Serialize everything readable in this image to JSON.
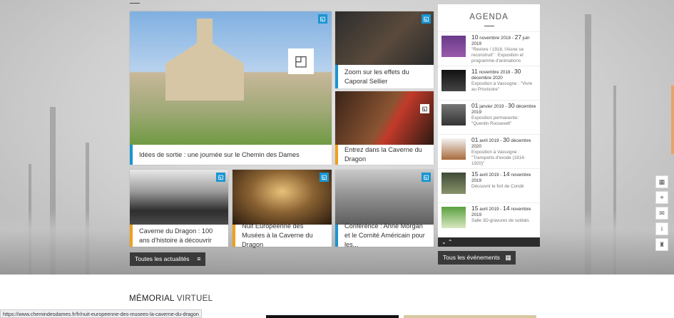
{
  "tiles": [
    {
      "caption": "Idées de sortie : une journée sur le Chemin des Dames",
      "accent": "#1a95d1"
    },
    {
      "caption": "Zoom sur les effets du Caporal Sellier",
      "accent": "#1a95d1"
    },
    {
      "caption": "Entrez dans la Caverne du Dragon",
      "accent": "#f0a01e"
    },
    {
      "caption": "Caverne du Dragon : 100 ans d'histoire à découvrir",
      "accent": "#f0a01e"
    },
    {
      "caption": "Nuit Européenne des Musées à la Caverne du Dragon",
      "accent": "#f0a01e"
    },
    {
      "caption": "Conférence : Anne Morgan et le Comité Américain pour les...",
      "accent": "#1a95d1"
    }
  ],
  "buttons": {
    "all_news": "Toutes les actualités",
    "all_events": "Tous les événements"
  },
  "agenda": {
    "title": "AGENDA",
    "events": [
      {
        "d1": "10",
        "m1": "novembre 2018",
        "sep": " - ",
        "d2": "27",
        "m2": "juin 2019",
        "desc": "\"Revivre ! 1918, l'Aisne se reconstruit\" : Exposition et programme d'animations"
      },
      {
        "d1": "11",
        "m1": "novembre 2018",
        "sep": " - ",
        "d2": "30",
        "m2": "décembre 2020",
        "desc": "Exposition à Vassogne : \"Vivre au Provisoire\""
      },
      {
        "d1": "01",
        "m1": "janvier 2019",
        "sep": " - ",
        "d2": "30",
        "m2": "décembre 2019",
        "desc": "Exposition permanente: \"Quentin Roosevelt\""
      },
      {
        "d1": "01",
        "m1": "avril 2019",
        "sep": " - ",
        "d2": "30",
        "m2": "décembre 2020",
        "desc": "Exposition à Vassogne : \"Transports d'exode (1914-1920)\""
      },
      {
        "d1": "15",
        "m1": "avril 2019",
        "sep": " - ",
        "d2": "14",
        "m2": "novembre 2019",
        "desc": "Découvrir le fort de Condé"
      },
      {
        "d1": "15",
        "m1": "avril 2019",
        "sep": " - ",
        "d2": "14",
        "m2": "novembre 2019",
        "desc": "Salle 3D-gravures de soldats"
      }
    ],
    "nav": "⌄ ⌃"
  },
  "section_title": {
    "part1": "MÉMORIAL",
    "part2": " VIRTUEL"
  },
  "status_url": "https://www.chemindesdames.fr/fr/nuit-europeenne-des-musees-la-caverne-du-dragon"
}
